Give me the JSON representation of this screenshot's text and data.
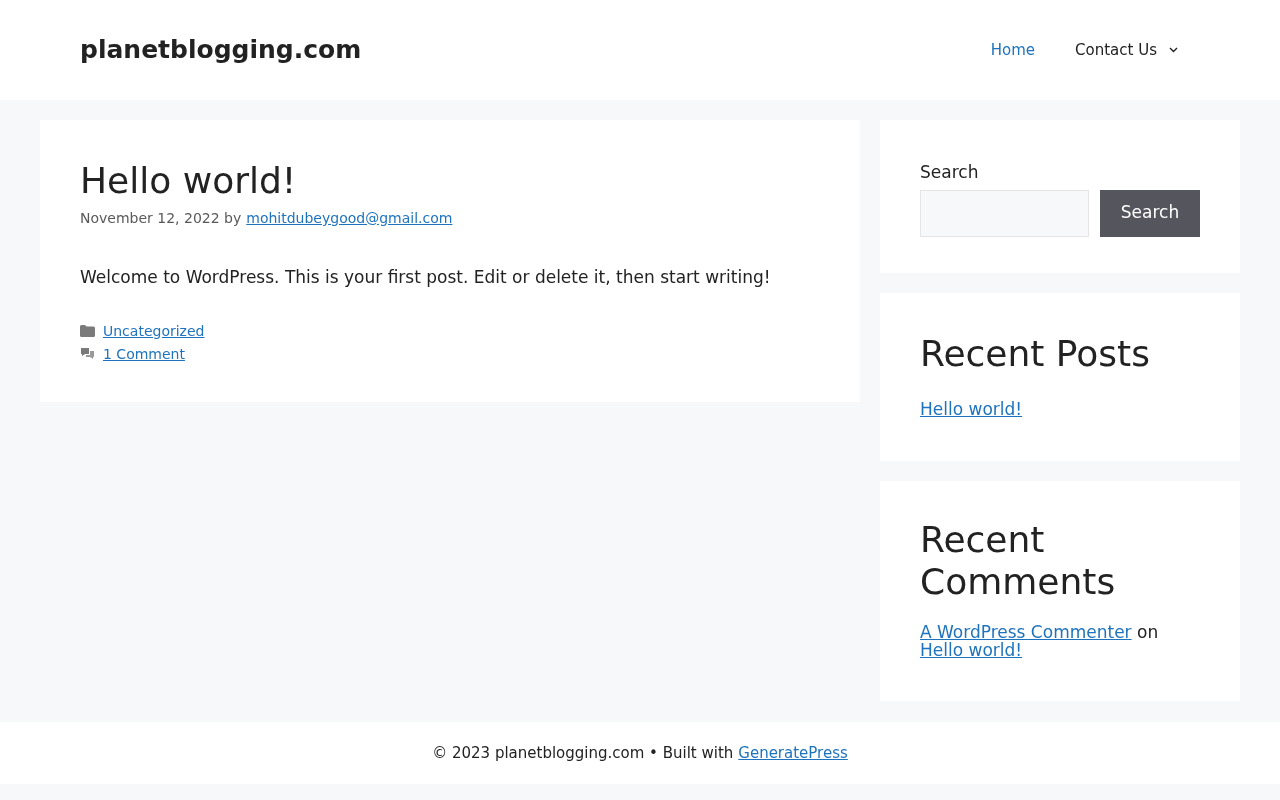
{
  "header": {
    "site_title": "planetblogging.com",
    "nav": [
      {
        "label": "Home",
        "selected": true,
        "has_dropdown": false
      },
      {
        "label": "Contact Us",
        "selected": false,
        "has_dropdown": true
      }
    ]
  },
  "post": {
    "title": "Hello world!",
    "date": "November 12, 2022",
    "by": "by",
    "author": "mohitdubeygood@gmail.com",
    "body": "Welcome to WordPress. This is your first post. Edit or delete it, then start writing!",
    "category": "Uncategorized",
    "comments": "1 Comment"
  },
  "sidebar": {
    "search": {
      "label": "Search",
      "button": "Search"
    },
    "recent_posts": {
      "title": "Recent Posts",
      "items": [
        "Hello world!"
      ]
    },
    "recent_comments": {
      "title": "Recent Comments",
      "items": [
        {
          "author": "A WordPress Commenter",
          "on": "on",
          "post": "Hello world!"
        }
      ]
    }
  },
  "footer": {
    "text": "© 2023 planetblogging.com • Built with",
    "link": "GeneratePress"
  }
}
